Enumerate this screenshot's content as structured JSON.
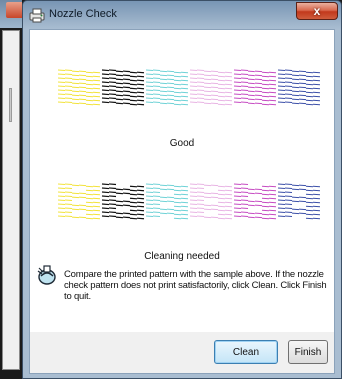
{
  "window": {
    "title": "Nozzle Check",
    "close_glyph": "x"
  },
  "results": [
    {
      "caption": "Good",
      "condition": "good"
    },
    {
      "caption": "Cleaning needed",
      "condition": "cleaning-needed"
    }
  ],
  "instructions": "Compare the printed pattern with the sample above. If the nozzle check pattern does not print satisfactorily, click Clean. Click Finish to quit.",
  "buttons": {
    "clean": "Clean",
    "finish": "Finish"
  },
  "colors": {
    "pattern": [
      "#f2e23a",
      "#111111",
      "#6fd2d6",
      "#e8b4e4",
      "#c64bc2",
      "#3b4fa8"
    ],
    "accent": "#3c7fb1",
    "close": "#c2391c"
  },
  "icons": {
    "window": "printer-icon",
    "instructions": "nozzle-check-icon",
    "close": "close-icon"
  }
}
